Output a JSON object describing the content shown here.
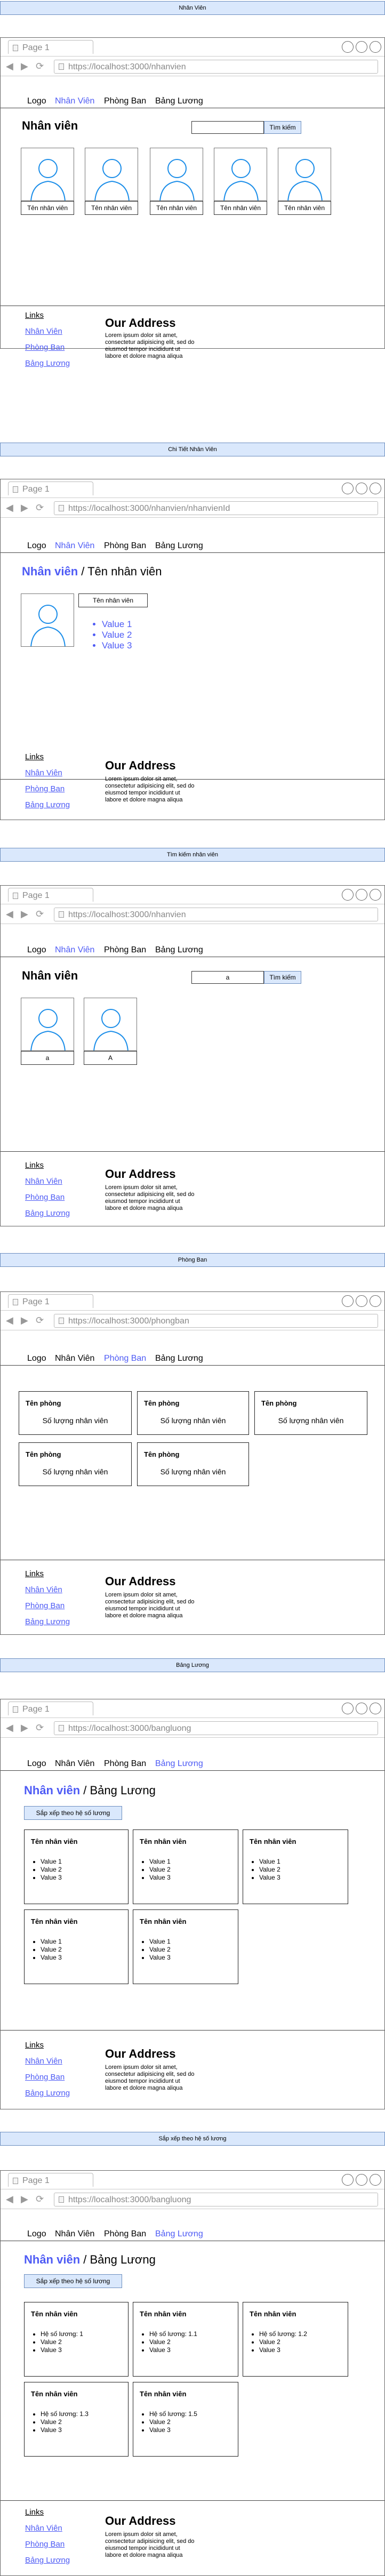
{
  "browser": {
    "tab_label": "Page 1"
  },
  "menu": {
    "logo": "Logo",
    "nhanvien": "Nhân Viên",
    "phongban": "Phòng Ban",
    "bangluong": "Bảng Lương"
  },
  "footer": {
    "links_title": "Links",
    "link1": "Nhân Viên",
    "link2": "Phòng Ban",
    "link3": "Bảng Lương",
    "address_title": "Our Address",
    "address_text": "Lorem ipsum dolor sit amet, consectetur adipisicing elit, sed do eiusmod tempor incididunt ut labore et dolore magna aliqua"
  },
  "s1": {
    "banner": "Nhân Viên",
    "url": "https://localhost:3000/nhanvien",
    "heading": "Nhân viên",
    "search_button": "Tìm kiếm",
    "employees": [
      "Tên nhân viên",
      "Tên nhân viên",
      "Tên nhân viên",
      "Tên nhân viên",
      "Tên nhân viên"
    ]
  },
  "s2": {
    "banner": "Chi Tiết Nhân Viên",
    "url": "https://localhost:3000/nhanvien/nhanvienId",
    "heading_main": "Nhân viên",
    "heading_tail": " / Tên nhân viên",
    "name_box": "Tên nhân viên",
    "values": [
      "Value 1",
      "Value 2",
      "Value 3"
    ]
  },
  "s3": {
    "banner": "Tìm kiếm nhân viên",
    "url": "https://localhost:3000/nhanvien",
    "heading": "Nhân viên",
    "search_value": "a",
    "search_button": "Tìm kiếm",
    "results": [
      "a",
      "A"
    ]
  },
  "s4": {
    "banner": "Phòng Ban",
    "url": "https://localhost:3000/phongban",
    "departments": [
      {
        "title": "Tên phòng",
        "sub": "Số lượng nhân viên"
      },
      {
        "title": "Tên phòng",
        "sub": "Số lượng nhân viên"
      },
      {
        "title": "Tên phòng",
        "sub": "Số lượng nhân viên"
      },
      {
        "title": "Tên phòng",
        "sub": "Số lượng nhân viên"
      },
      {
        "title": "Tên phòng",
        "sub": "Số lượng nhân viên"
      }
    ]
  },
  "s5": {
    "banner": "Bảng Lương",
    "url": "https://localhost:3000/bangluong",
    "heading_main": "Nhân viên",
    "heading_tail": " / Bảng Lương",
    "sort_button": "Sắp xếp theo hệ số lương",
    "cards": [
      {
        "title": "Tên nhân viên",
        "items": [
          "Value 1",
          "Value 2",
          "Value 3"
        ]
      },
      {
        "title": "Tên nhân viên",
        "items": [
          "Value 1",
          "Value 2",
          "Value 3"
        ]
      },
      {
        "title": "Tên nhân viên",
        "items": [
          "Value 1",
          "Value 2",
          "Value 3"
        ]
      },
      {
        "title": "Tên nhân viên",
        "items": [
          "Value 1",
          "Value 2",
          "Value 3"
        ]
      },
      {
        "title": "Tên nhân viên",
        "items": [
          "Value 1",
          "Value 2",
          "Value 3"
        ]
      }
    ]
  },
  "s6": {
    "banner": "Sắp xếp theo hệ số lương",
    "url": "https://localhost:3000/bangluong",
    "heading_main": "Nhân viên",
    "heading_tail": " / Bảng Lương",
    "sort_button": "Sắp xếp theo hệ số lương",
    "cards": [
      {
        "title": "Tên nhân viên",
        "items": [
          "Hệ số lương: 1",
          "Value 2",
          "Value 3"
        ]
      },
      {
        "title": "Tên nhân viên",
        "items": [
          "Hệ số lương: 1.1",
          "Value 2",
          "Value 3"
        ]
      },
      {
        "title": "Tên nhân viên",
        "items": [
          "Hệ số lương: 1.2",
          "Value 2",
          "Value 3"
        ]
      },
      {
        "title": "Tên nhân viên",
        "items": [
          "Hệ số lương: 1.3",
          "Value 2",
          "Value 3"
        ]
      },
      {
        "title": "Tên nhân viên",
        "items": [
          "Hệ số lương: 1.5",
          "Value 2",
          "Value 3"
        ]
      }
    ]
  }
}
